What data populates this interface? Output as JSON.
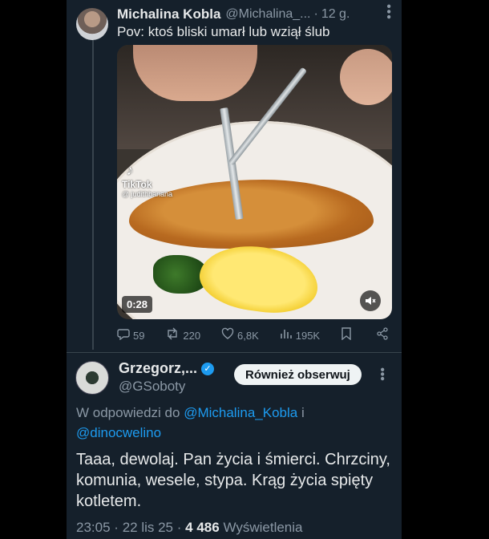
{
  "tweet1": {
    "name": "Michalina Kobla",
    "handle": "@Michalina_...",
    "separator": "·",
    "time": "12 g.",
    "text": "Pov: ktoś bliski umarł lub wziął ślub",
    "video": {
      "watermark_brand": "TikTok",
      "watermark_user": "@ judithbanana",
      "duration": "0:28",
      "mute_icon": "speaker-muted-icon"
    },
    "stats": {
      "replies": "59",
      "reposts": "220",
      "likes": "6,8K",
      "views": "195K"
    }
  },
  "tweet2": {
    "name": "Grzegorz,...",
    "handle": "@GSoboty",
    "follow_label": "Również obserwuj",
    "reply_prefix": "W odpowiedzi do",
    "reply_user1": "@Michalina_Kobla",
    "reply_and": "i",
    "reply_user2": "@dinocwelino",
    "text": "Taaa, dewolaj. Pan życia i śmierci. Chrzciny, komunia, wesele, stypa. Krąg życia spięty kotletem.",
    "time": "23:05",
    "date": "22 lis 25",
    "views_count": "4 486",
    "views_label": "Wyświetlenia",
    "sep": "·"
  },
  "colors": {
    "background": "#15202b",
    "text": "#e7e9ea",
    "muted": "#8b98a5",
    "accent": "#1d9bf0"
  }
}
